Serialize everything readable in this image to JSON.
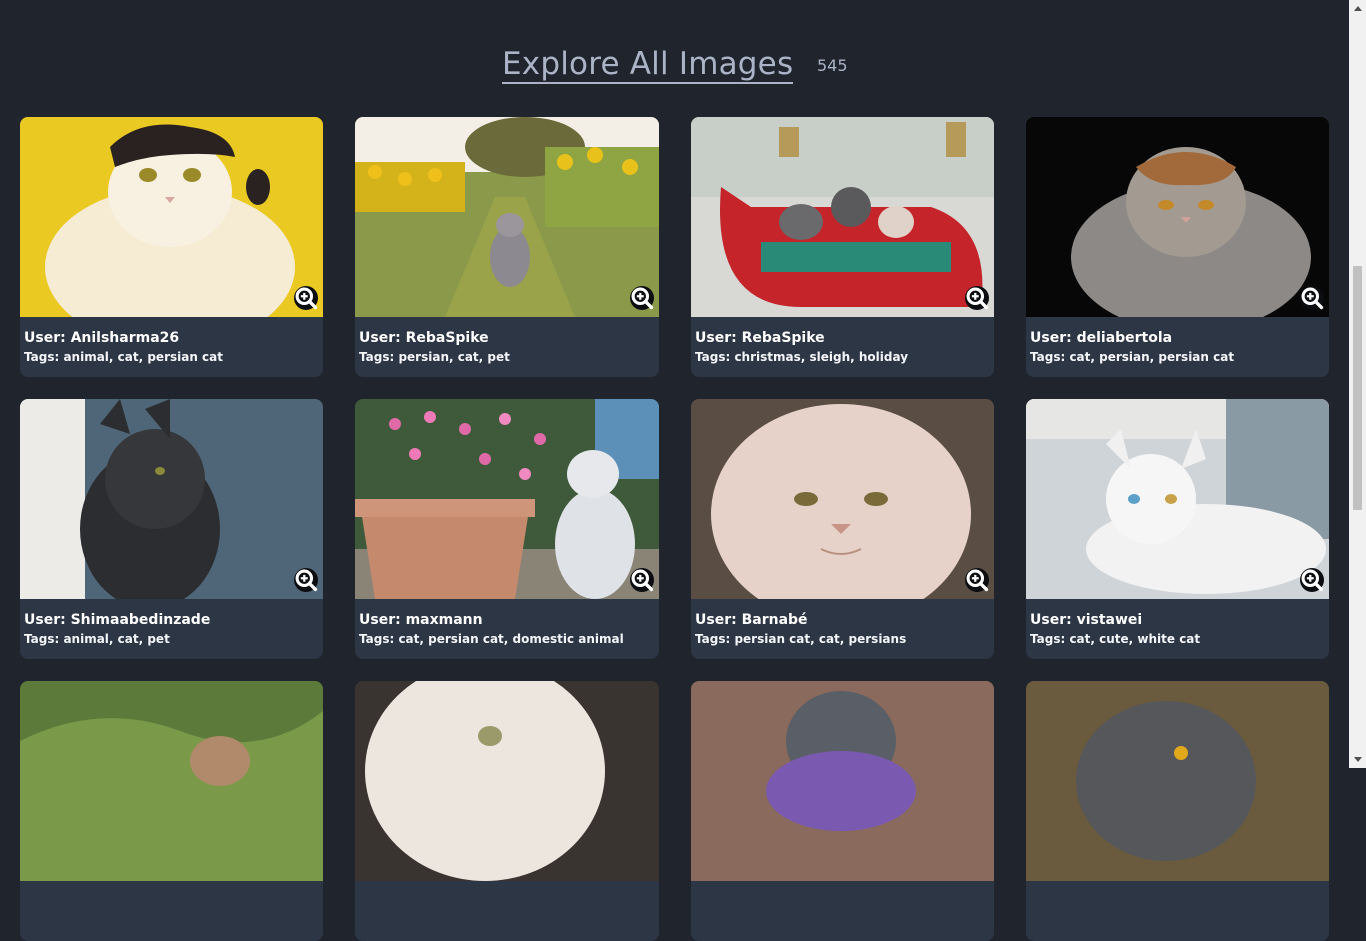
{
  "header": {
    "title": "Explore All Images",
    "count": "545"
  },
  "cards": [
    {
      "user": "User: Anilsharma26",
      "tags": "Tags: animal, cat, persian cat"
    },
    {
      "user": "User: RebaSpike",
      "tags": "Tags: persian, cat, pet"
    },
    {
      "user": "User: RebaSpike",
      "tags": "Tags: christmas, sleigh, holiday"
    },
    {
      "user": "User: deliabertola",
      "tags": "Tags: cat, persian, persian cat"
    },
    {
      "user": "User: Shimaabedinzade",
      "tags": "Tags: animal, cat, pet"
    },
    {
      "user": "User: maxmann",
      "tags": "Tags: cat, persian cat, domestic animal"
    },
    {
      "user": "User: Barnabé",
      "tags": "Tags: persian cat, cat, persians"
    },
    {
      "user": "User: vistawei",
      "tags": "Tags: cat, cute, white cat"
    },
    {
      "user": "",
      "tags": ""
    },
    {
      "user": "",
      "tags": ""
    },
    {
      "user": "",
      "tags": ""
    },
    {
      "user": "",
      "tags": ""
    }
  ],
  "icons": {
    "zoom": "zoom-in-icon",
    "scroll_up": "arrow-up-icon",
    "scroll_down": "arrow-down-icon"
  },
  "colors": {
    "background": "#1f242d",
    "card": "#2d3645",
    "title": "#aab4c6"
  }
}
